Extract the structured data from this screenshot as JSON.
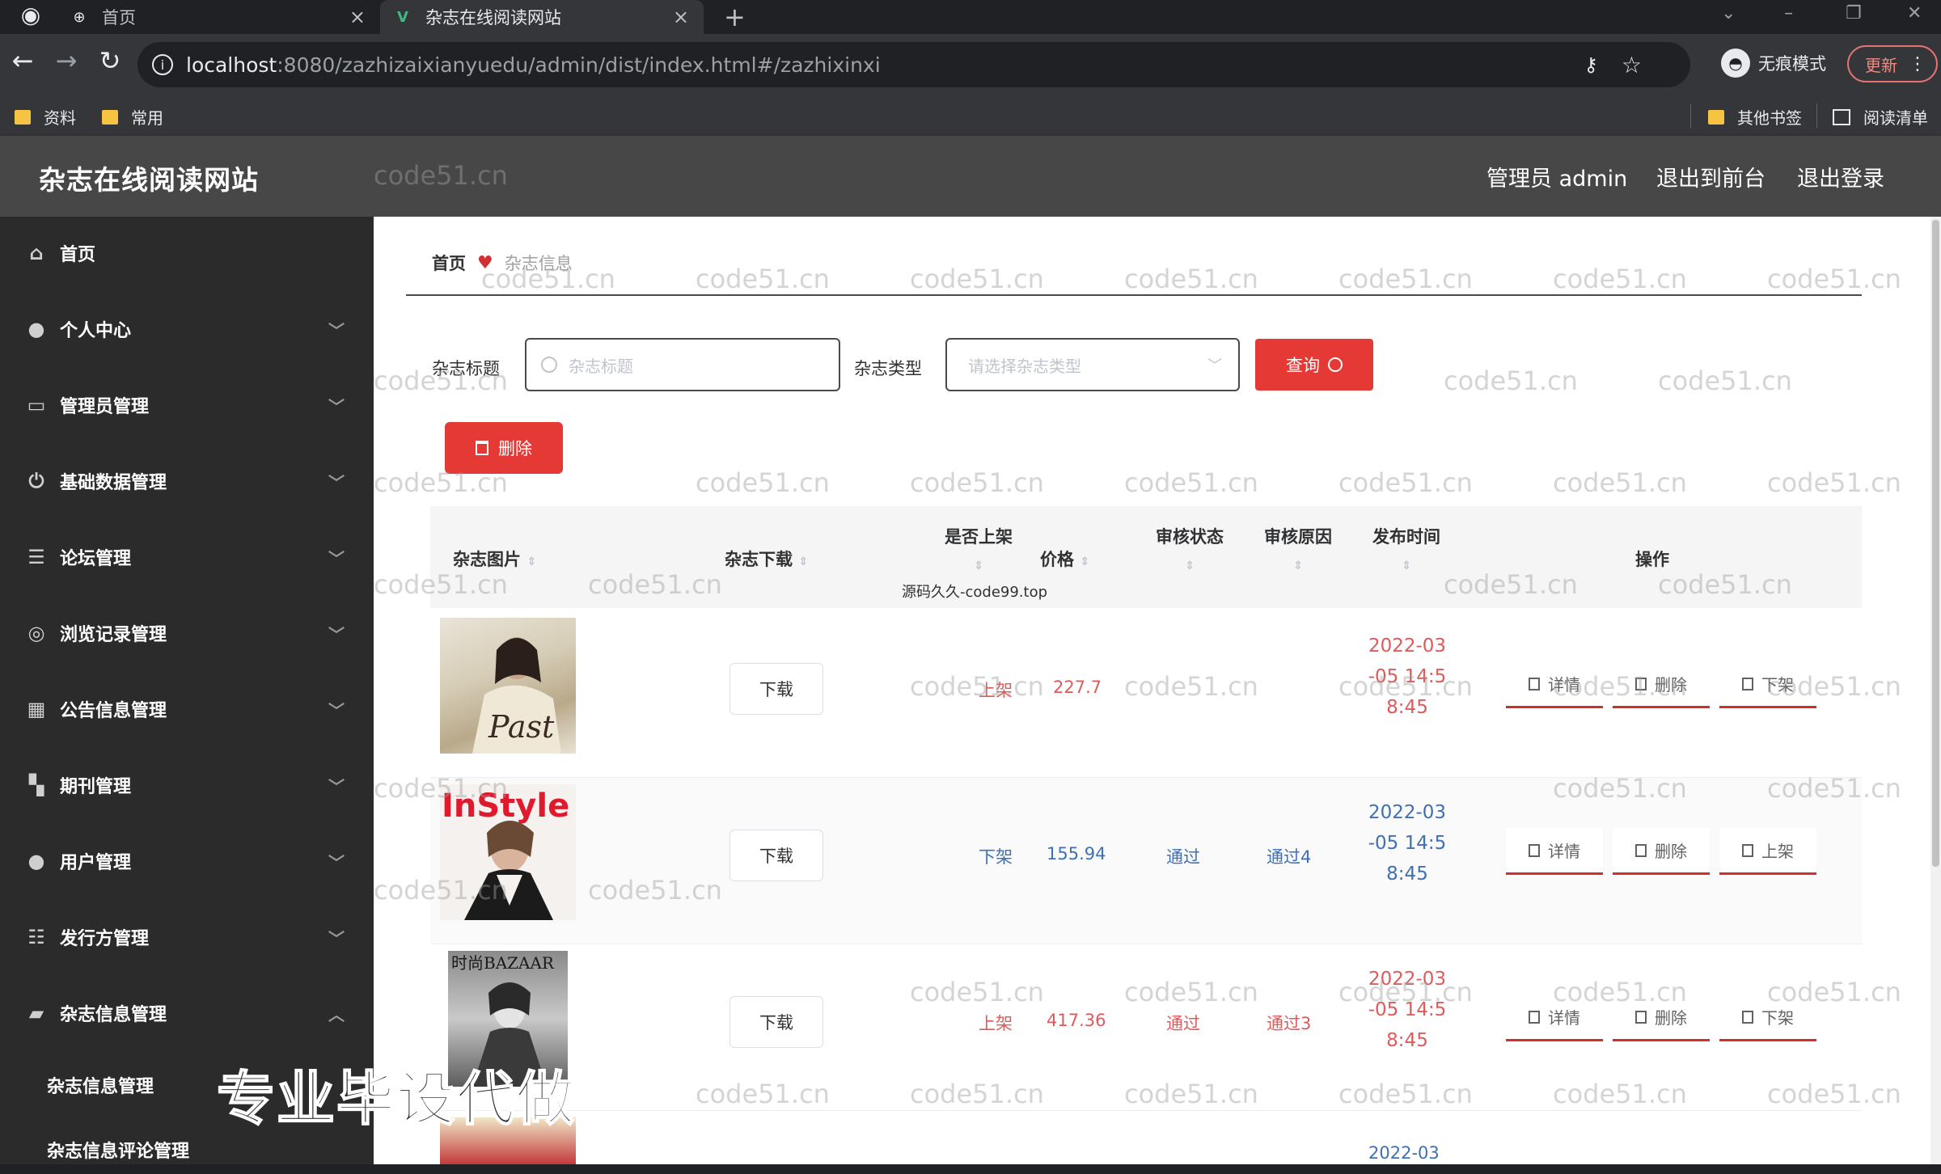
{
  "browser": {
    "tabs": [
      {
        "label": "首页"
      },
      {
        "label": "杂志在线阅读网站"
      }
    ],
    "url_host": "localhost",
    "url_path": ":8080/zazhizaixianyuedu/admin/dist/index.html#/zazhixinxi",
    "incognito_label": "无痕模式",
    "update_label": "更新",
    "bookmarks": [
      {
        "label": "资料"
      },
      {
        "label": "常用"
      }
    ],
    "other_bookmarks_label": "其他书签",
    "reading_list_label": "阅读清单"
  },
  "header": {
    "title": "杂志在线阅读网站",
    "admin_label": "管理员 admin",
    "back_front_label": "退出到前台",
    "logout_label": "退出登录"
  },
  "sidebar": {
    "items": [
      {
        "label": "首页",
        "icon": "home-icon"
      },
      {
        "label": "个人中心",
        "icon": "user-icon"
      },
      {
        "label": "管理员管理",
        "icon": "admin-icon"
      },
      {
        "label": "基础数据管理",
        "icon": "power-icon"
      },
      {
        "label": "论坛管理",
        "icon": "list-icon"
      },
      {
        "label": "浏览记录管理",
        "icon": "history-icon"
      },
      {
        "label": "公告信息管理",
        "icon": "grid-icon"
      },
      {
        "label": "期刊管理",
        "icon": "blocks-icon"
      },
      {
        "label": "用户管理",
        "icon": "pin-icon"
      },
      {
        "label": "发行方管理",
        "icon": "sliders-icon"
      },
      {
        "label": "杂志信息管理",
        "icon": "briefcase-icon"
      }
    ],
    "subitems": [
      {
        "label": "杂志信息管理"
      },
      {
        "label": "杂志信息评论管理"
      }
    ]
  },
  "breadcrumb": {
    "home": "首页",
    "current": "杂志信息"
  },
  "search": {
    "title_label": "杂志标题",
    "title_placeholder": "杂志标题",
    "type_label": "杂志类型",
    "type_placeholder": "请选择杂志类型",
    "query_label": "查询"
  },
  "delete_button_label": "删除",
  "table": {
    "headers": {
      "image": "杂志图片",
      "download": "杂志下载",
      "listed": "是否上架",
      "price": "价格",
      "review_status": "审核状态",
      "review_reason": "审核原因",
      "publish_time": "发布时间",
      "actions": "操作"
    },
    "rows": [
      {
        "download": "下载",
        "listed": "上架",
        "price": "227.7",
        "review_status": "",
        "review_reason": "",
        "date_1": "2022-03",
        "date_2": "-05 14:5",
        "date_3": "8:45",
        "detail": "详情",
        "delete": "删除",
        "toggle": "下架"
      },
      {
        "download": "下载",
        "listed": "下架",
        "price": "155.94",
        "review_status": "通过",
        "review_reason": "通过4",
        "date_1": "2022-03",
        "date_2": "-05 14:5",
        "date_3": "8:45",
        "detail": "详情",
        "delete": "删除",
        "toggle": "上架"
      },
      {
        "download": "下载",
        "listed": "上架",
        "price": "417.36",
        "review_status": "通过",
        "review_reason": "通过3",
        "date_1": "2022-03",
        "date_2": "-05 14:5",
        "date_3": "8:45",
        "detail": "详情",
        "delete": "删除",
        "toggle": "下架"
      }
    ],
    "partial_next_date": "2022-03"
  },
  "overlay": {
    "source_note": "源码久久-code99.top",
    "promo": "专业毕设代做",
    "watermark": "code51.cn"
  },
  "colors": {
    "accent_red": "#e53935",
    "sidebar_bg": "#2b2b2b",
    "header_bg": "#474747",
    "status_blue": "#3f6fb5",
    "status_red": "#e05a5a"
  }
}
